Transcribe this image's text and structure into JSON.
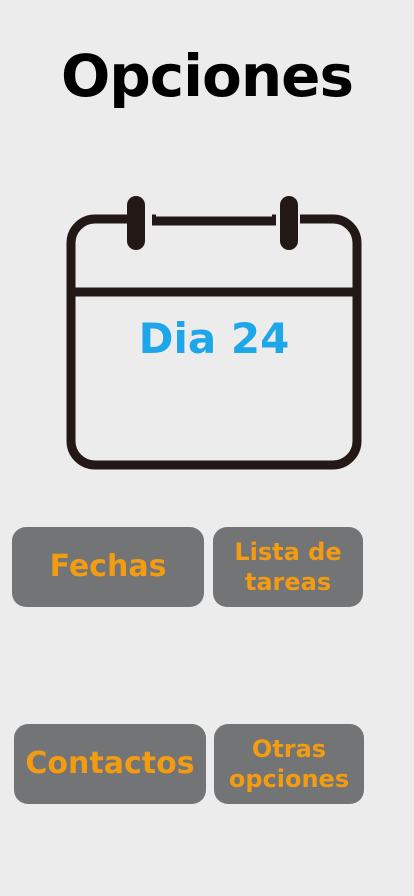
{
  "header": {
    "title": "Opciones"
  },
  "calendar": {
    "icon": "calendar-icon",
    "day_label": "Dia 24",
    "day_color": "#1ea7e8"
  },
  "options": {
    "fechas": "Fechas",
    "lista_tareas": "Lista de tareas",
    "contactos": "Contactos",
    "otras_opciones": "Otras opciones"
  },
  "colors": {
    "background": "#ececec",
    "button_bg": "#727476",
    "button_text": "#f39c12",
    "icon_stroke": "#231815"
  }
}
